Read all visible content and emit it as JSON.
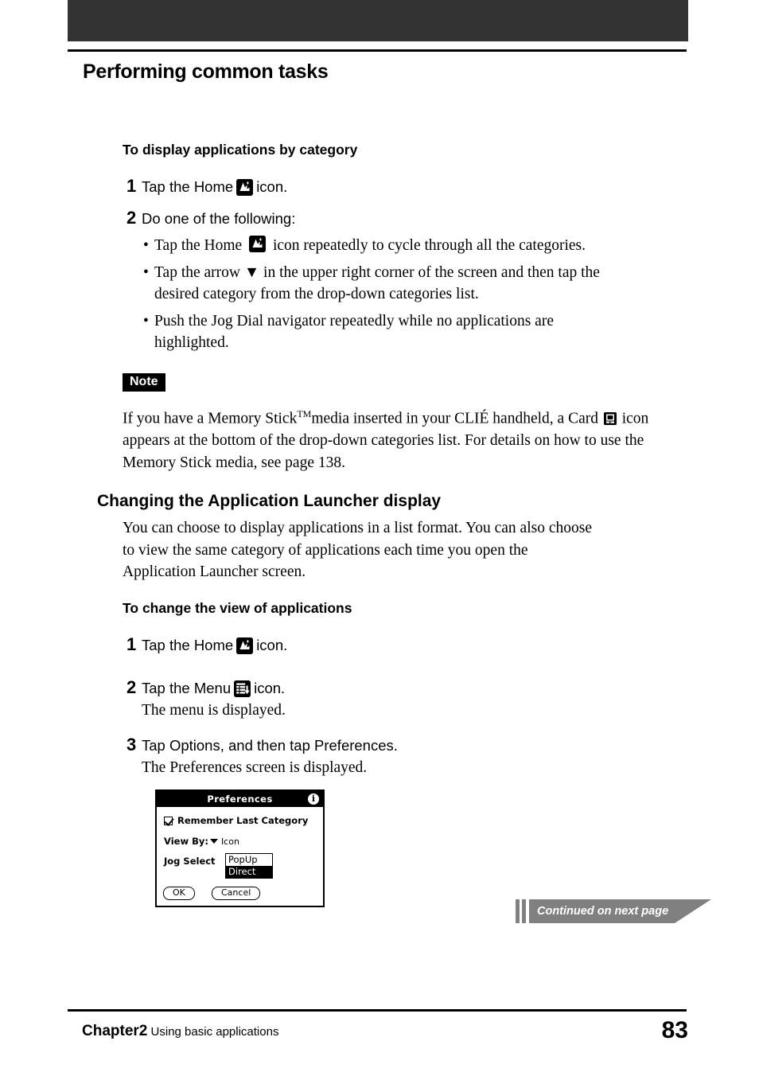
{
  "page_title": "Performing common tasks",
  "sections": [
    {
      "heading": "To display applications by category",
      "steps": [
        {
          "num": "1",
          "before": "Tap the Home",
          "icon": "home-icon",
          "after": "icon."
        },
        {
          "num": "2",
          "before": "Do one of the following:",
          "icon": null,
          "after": ""
        }
      ],
      "bullets": [
        {
          "dot": "•",
          "before": "Tap the Home",
          "icon": "home-icon",
          "after": "icon repeatedly to cycle through all the categories."
        },
        {
          "dot": "•",
          "line1": "Tap the arrow ▼ in the upper right corner of the screen and then tap the",
          "line2": "desired category from the drop-down categories list."
        },
        {
          "dot": "•",
          "line1": "Push the Jog Dial navigator repeatedly while no applications are",
          "line2": "highlighted."
        }
      ]
    }
  ],
  "note": {
    "label": "Note",
    "line1_a": "If you have a Memory Stick",
    "line1_tm": "TM",
    "line1_b": "media inserted in your CLIÉ handheld, a Card",
    "line1_icon": "card-icon",
    "line1_c": "icon",
    "line2": "appears at the bottom of the drop-down categories list. For details on how to use the",
    "line3": "Memory Stick media, see page 138."
  },
  "section2": {
    "heading": "Changing the Application Launcher display",
    "paragraph_line1": "You can choose to display applications in a list format. You can also choose",
    "paragraph_line2": "to view the same category of applications each time you open the",
    "paragraph_line3": "Application Launcher screen.",
    "subheading": "To change the view of applications",
    "steps": [
      {
        "num": "1",
        "before": "Tap the Home",
        "icon": "home-icon",
        "after": "icon.",
        "result": ""
      },
      {
        "num": "2",
        "before": "Tap the Menu",
        "icon": "menu-icon",
        "after": "icon.",
        "result": "The menu is displayed."
      },
      {
        "num": "3",
        "before": "Tap Options, and then tap Preferences.",
        "icon": null,
        "after": "",
        "result": "The Preferences screen is displayed."
      }
    ]
  },
  "preferences_screen": {
    "title": "Preferences",
    "info_icon_label": "i",
    "checkbox_label": "Remember Last Category",
    "checkbox_checked": true,
    "view_by_label": "View By:",
    "view_by_value": "Icon",
    "jog_select_label": "Jog Select",
    "popup_options": [
      {
        "label": "PopUp",
        "selected": false
      },
      {
        "label": "Direct",
        "selected": true
      }
    ],
    "ok_button": "OK",
    "cancel_button": "Cancel"
  },
  "continued_banner": "Continued on next page",
  "footer": {
    "chapter": "Chapter2",
    "chapter_desc": "Using basic applications",
    "page_number": "83"
  },
  "colors": {
    "header_band": "#333333",
    "banner_gray": "#808080",
    "text": "#000000"
  }
}
